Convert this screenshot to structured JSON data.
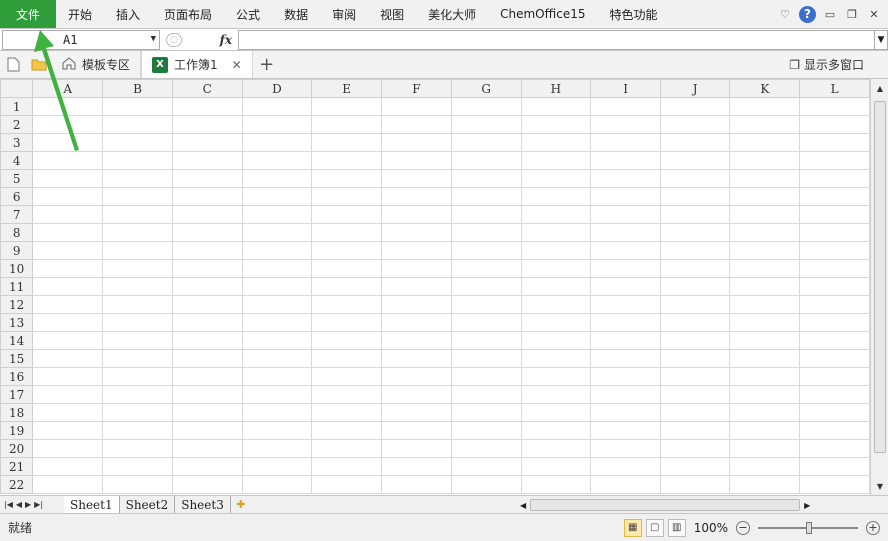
{
  "ribbon": {
    "tabs": [
      "文件",
      "开始",
      "插入",
      "页面布局",
      "公式",
      "数据",
      "审阅",
      "视图",
      "美化大师",
      "ChemOffice15",
      "特色功能"
    ],
    "window_controls": [
      "heart-icon",
      "help-icon",
      "minimize-icon",
      "restore-icon",
      "close-icon"
    ],
    "help_label": "?"
  },
  "formula_bar": {
    "name_box": "A1",
    "fx_label": "fx",
    "formula_value": ""
  },
  "doc_tabs": {
    "template_tab": "模板专区",
    "workbook_tab": "工作簿1",
    "multi_window": "显示多窗口"
  },
  "grid": {
    "columns": [
      "A",
      "B",
      "C",
      "D",
      "E",
      "F",
      "G",
      "H",
      "I",
      "J",
      "K",
      "L"
    ],
    "rows": [
      "1",
      "2",
      "3",
      "4",
      "5",
      "6",
      "7",
      "8",
      "9",
      "10",
      "11",
      "12",
      "13",
      "14",
      "15",
      "16",
      "17",
      "18",
      "19",
      "20",
      "21",
      "22"
    ]
  },
  "sheets": [
    "Sheet1",
    "Sheet2",
    "Sheet3"
  ],
  "status": {
    "ready": "就绪",
    "zoom": "100%"
  },
  "colors": {
    "file_tab": "#2f9d3a",
    "annotation_arrow": "#3fb23f"
  }
}
